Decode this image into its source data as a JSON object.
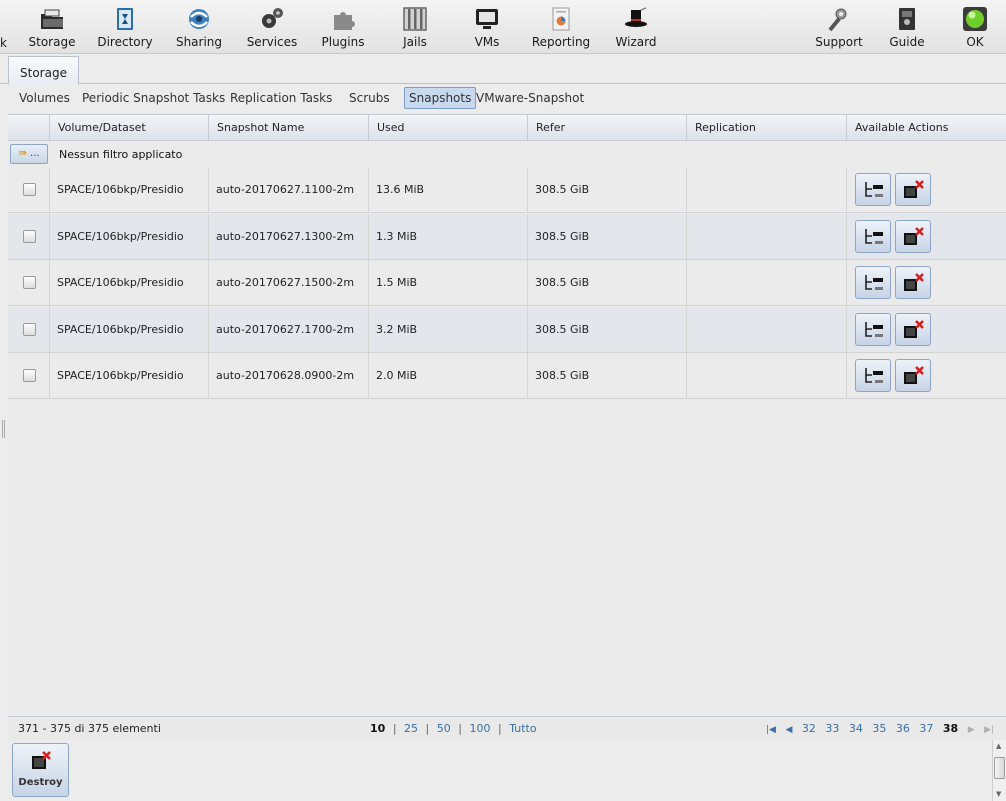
{
  "toolbar": {
    "left_edge_glyph": "k",
    "items": [
      {
        "label": "Storage",
        "icon": "storage-icon"
      },
      {
        "label": "Directory",
        "icon": "directory-icon"
      },
      {
        "label": "Sharing",
        "icon": "sharing-icon"
      },
      {
        "label": "Services",
        "icon": "services-icon"
      },
      {
        "label": "Plugins",
        "icon": "plugins-icon"
      },
      {
        "label": "Jails",
        "icon": "jails-icon"
      },
      {
        "label": "VMs",
        "icon": "vms-icon"
      },
      {
        "label": "Reporting",
        "icon": "reporting-icon"
      },
      {
        "label": "Wizard",
        "icon": "wizard-icon"
      },
      {
        "label": "Support",
        "icon": "support-icon"
      },
      {
        "label": "Guide",
        "icon": "guide-icon"
      },
      {
        "label": "OK",
        "icon": "status-ok-icon"
      }
    ]
  },
  "main_tab": {
    "label": "Storage"
  },
  "subtabs": [
    {
      "label": "Volumes",
      "active": false
    },
    {
      "label": "Periodic Snapshot Tasks",
      "active": false
    },
    {
      "label": "Replication Tasks",
      "active": false
    },
    {
      "label": "Scrubs",
      "active": false
    },
    {
      "label": "Snapshots",
      "active": true
    },
    {
      "label": "VMware-Snapshot",
      "active": false
    }
  ],
  "grid": {
    "columns": [
      "Volume/Dataset",
      "Snapshot Name",
      "Used",
      "Refer",
      "Replication",
      "Available Actions"
    ],
    "filter_button_label": "...",
    "filter_text": "Nessun filtro applicato",
    "rows": [
      {
        "volume": "SPACE/106bkp/Presidio",
        "snapshot": "auto-20170627.1100-2m",
        "used": "13.6 MiB",
        "refer": "308.5 GiB",
        "replication": ""
      },
      {
        "volume": "SPACE/106bkp/Presidio",
        "snapshot": "auto-20170627.1300-2m",
        "used": "1.3 MiB",
        "refer": "308.5 GiB",
        "replication": ""
      },
      {
        "volume": "SPACE/106bkp/Presidio",
        "snapshot": "auto-20170627.1500-2m",
        "used": "1.5 MiB",
        "refer": "308.5 GiB",
        "replication": ""
      },
      {
        "volume": "SPACE/106bkp/Presidio",
        "snapshot": "auto-20170627.1700-2m",
        "used": "3.2 MiB",
        "refer": "308.5 GiB",
        "replication": ""
      },
      {
        "volume": "SPACE/106bkp/Presidio",
        "snapshot": "auto-20170628.0900-2m",
        "used": "2.0 MiB",
        "refer": "308.5 GiB",
        "replication": ""
      }
    ]
  },
  "footer": {
    "count_text": "371 - 375 di 375 elementi",
    "page_sizes": [
      "10",
      "25",
      "50",
      "100",
      "Tutto"
    ],
    "current_page_size": "10",
    "pages": [
      "32",
      "33",
      "34",
      "35",
      "36",
      "37",
      "38"
    ],
    "current_page": "38"
  },
  "bottom_actions": {
    "destroy_label": "Destroy"
  },
  "colors": {
    "active_tab": "#c9daf0",
    "link": "#3a6fa8",
    "delete_red": "#d42020"
  }
}
